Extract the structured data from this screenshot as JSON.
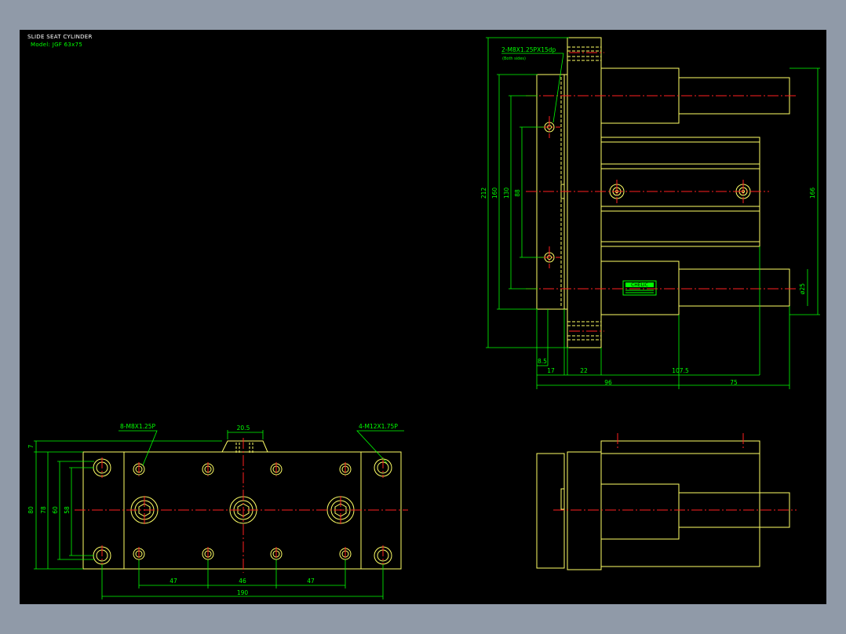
{
  "title_block": {
    "title": "SLIDE SEAT CYLINDER",
    "model": "Model: JGF 63x75"
  },
  "colors": {
    "background": "#000000",
    "outline": "#ffff66",
    "dimension": "#00ff00",
    "centerline": "#ff2020",
    "frame": "#909aa8"
  },
  "side_view": {
    "callout": "2-M8X1.25PX15dp",
    "callout_note": "(Both sides)",
    "dims": {
      "d212": "212",
      "d160": "160",
      "d130": "130",
      "d88": "88",
      "d166": "166",
      "d25": "ø25",
      "d8_5": "8.5",
      "d17": "17",
      "d22": "22",
      "d107_5": "107.5",
      "d96": "96",
      "d75": "75"
    },
    "nameplate": "CHELIC"
  },
  "bottom_view": {
    "callout_left": "8-M8X1.25P",
    "callout_right": "4-M12X1.75P",
    "dims": {
      "d20_5": "20.5",
      "d7": "7",
      "d80": "80",
      "d78": "78",
      "d60": "60",
      "d58": "58",
      "d47a": "47",
      "d46": "46",
      "d47b": "47",
      "d190": "190"
    }
  }
}
